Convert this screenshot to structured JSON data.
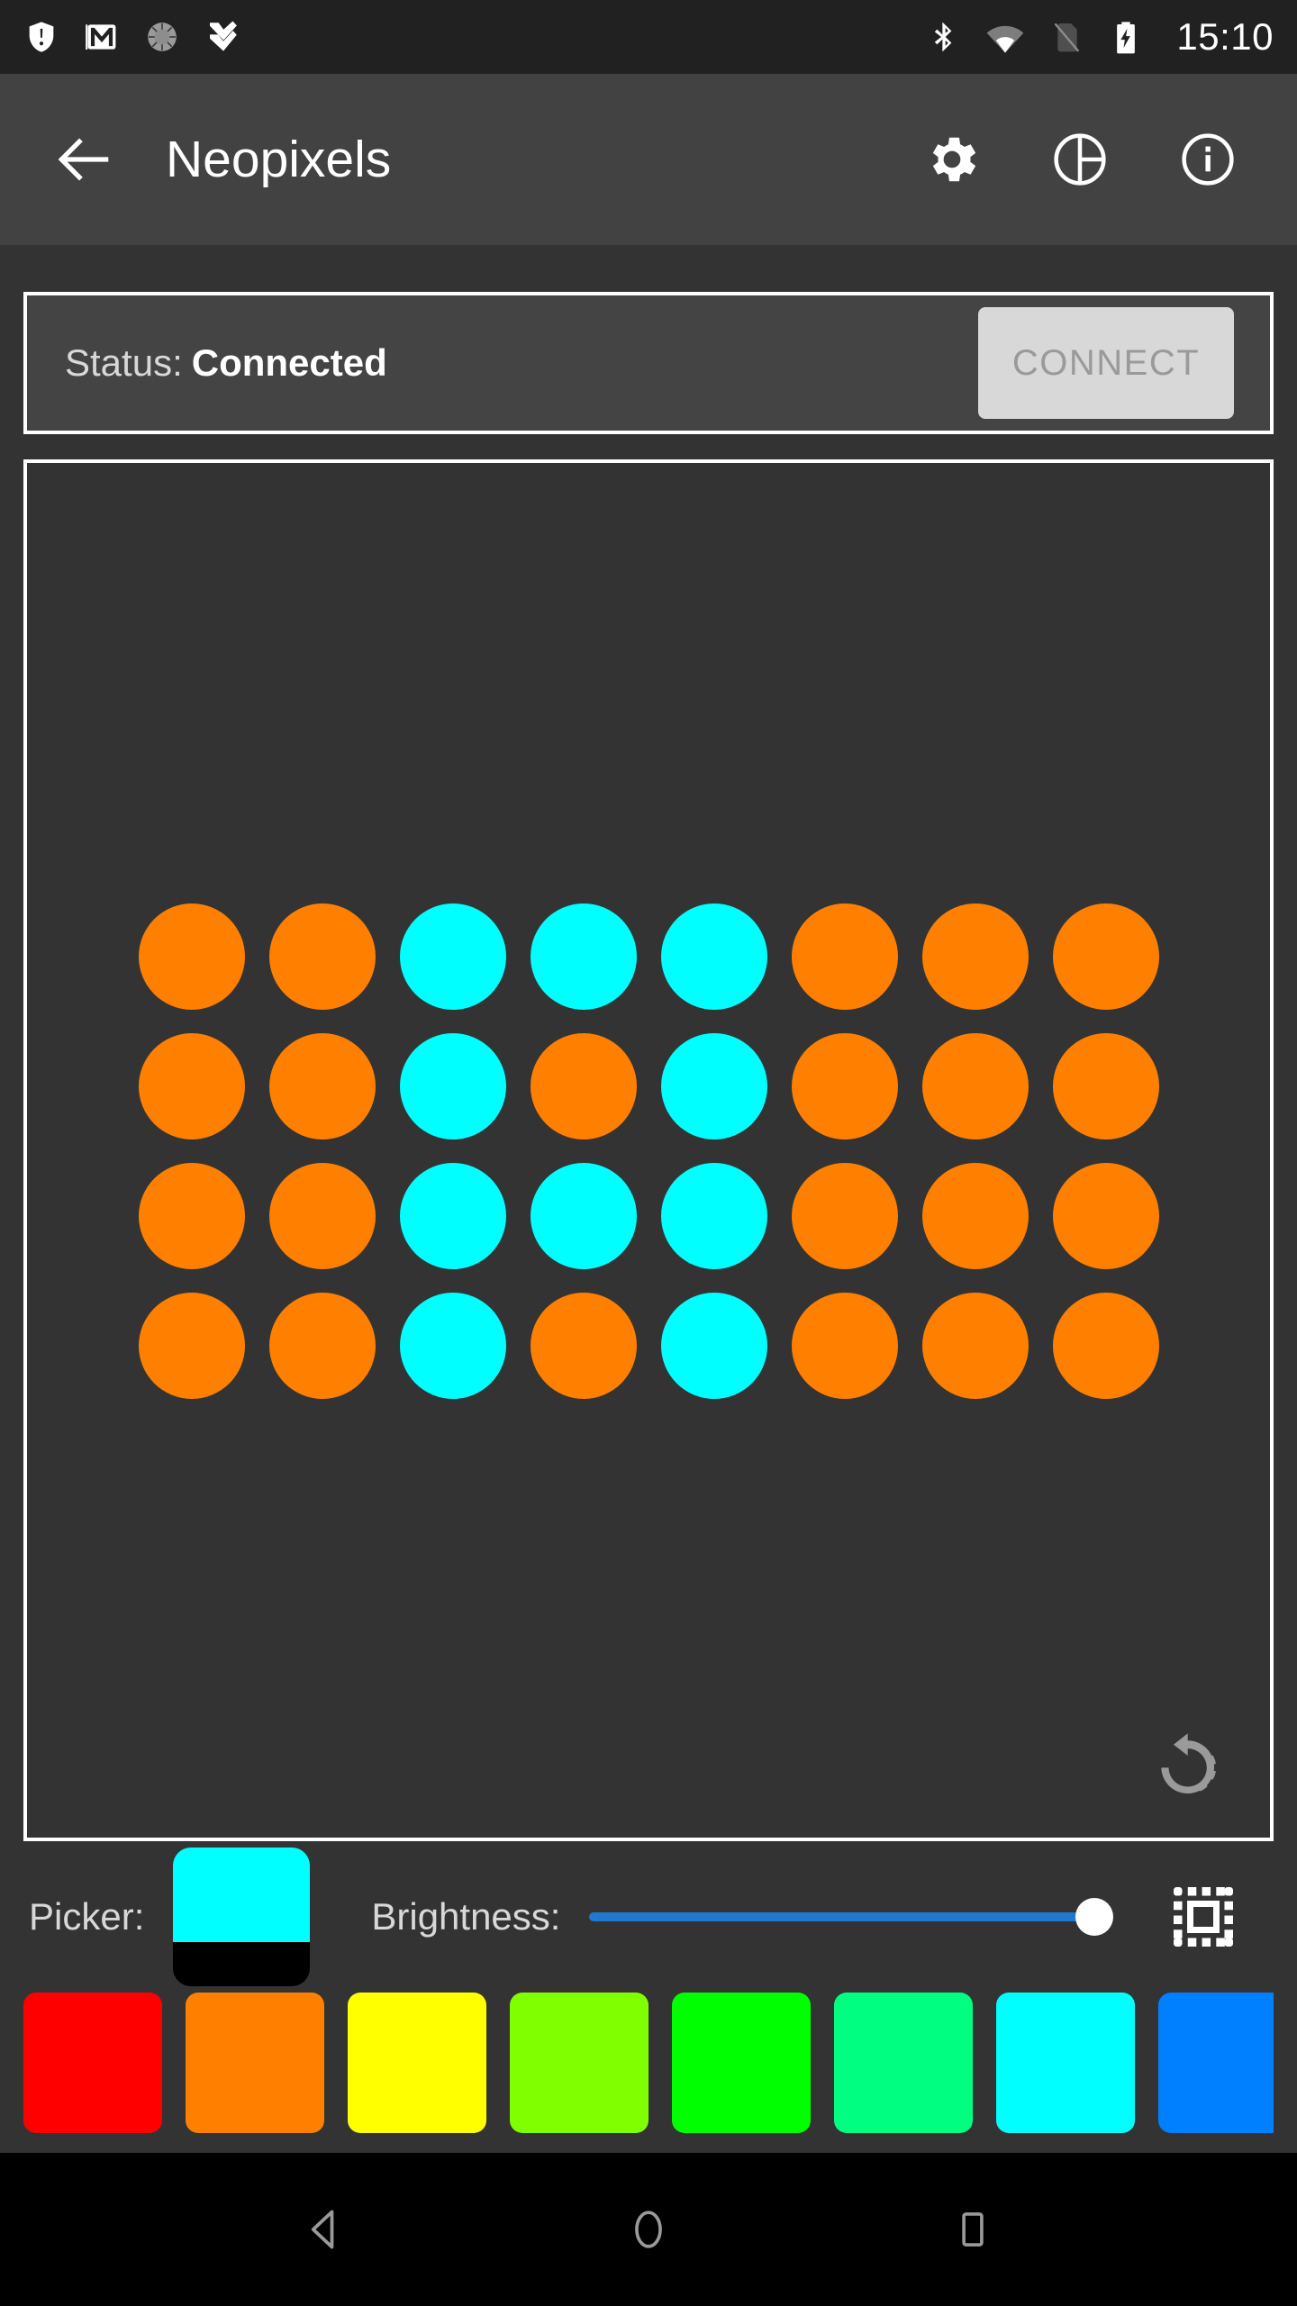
{
  "statusbar": {
    "time": "15:10",
    "left_icons": [
      "security-shield-icon",
      "gmail-icon",
      "sync-spinner-icon",
      "tasks-check-icon"
    ],
    "right_icons": [
      "bluetooth-icon",
      "wifi-icon",
      "no-sim-icon",
      "battery-charging-icon"
    ]
  },
  "appbar": {
    "back_label": "back-arrow",
    "title": "Neopixels",
    "actions": [
      {
        "name": "settings-gear-icon",
        "label": "Settings"
      },
      {
        "name": "pie-chart-icon",
        "label": "Components"
      },
      {
        "name": "info-icon",
        "label": "Info"
      }
    ]
  },
  "status_card": {
    "label": "Status:",
    "value": "Connected",
    "connect_button": "CONNECT",
    "connect_enabled": false
  },
  "board": {
    "rows": 4,
    "cols": 8,
    "colors": {
      "orange": "#FF8000",
      "cyan": "#00FFFF"
    },
    "leds": [
      [
        "#FF8000",
        "#FF8000",
        "#00FFFF",
        "#00FFFF",
        "#00FFFF",
        "#FF8000",
        "#FF8000",
        "#FF8000"
      ],
      [
        "#FF8000",
        "#FF8000",
        "#00FFFF",
        "#FF8000",
        "#00FFFF",
        "#FF8000",
        "#FF8000",
        "#FF8000"
      ],
      [
        "#FF8000",
        "#FF8000",
        "#00FFFF",
        "#00FFFF",
        "#00FFFF",
        "#FF8000",
        "#FF8000",
        "#FF8000"
      ],
      [
        "#FF8000",
        "#FF8000",
        "#00FFFF",
        "#FF8000",
        "#00FFFF",
        "#FF8000",
        "#FF8000",
        "#FF8000"
      ]
    ],
    "rotate_icon": "rotate-icon"
  },
  "controls": {
    "picker_label": "Picker:",
    "picker_color": "#00FFFF",
    "brightness_label": "Brightness:",
    "brightness_value": 100,
    "slider_color": "#1F78D1",
    "select_all_icon": "select-all-icon"
  },
  "palette": {
    "swatches": [
      {
        "name": "red",
        "color": "#FF0000"
      },
      {
        "name": "orange",
        "color": "#FF8000"
      },
      {
        "name": "yellow",
        "color": "#FFFF00"
      },
      {
        "name": "yellow-green",
        "color": "#80FF00"
      },
      {
        "name": "green",
        "color": "#00FF00"
      },
      {
        "name": "spring-green",
        "color": "#00FF80"
      },
      {
        "name": "cyan",
        "color": "#00FFFF"
      },
      {
        "name": "blue",
        "color": "#0080FF"
      }
    ]
  },
  "navbar": {
    "buttons": [
      {
        "name": "nav-back-icon",
        "label": "Back"
      },
      {
        "name": "nav-home-icon",
        "label": "Home"
      },
      {
        "name": "nav-recents-icon",
        "label": "Recents"
      }
    ]
  }
}
